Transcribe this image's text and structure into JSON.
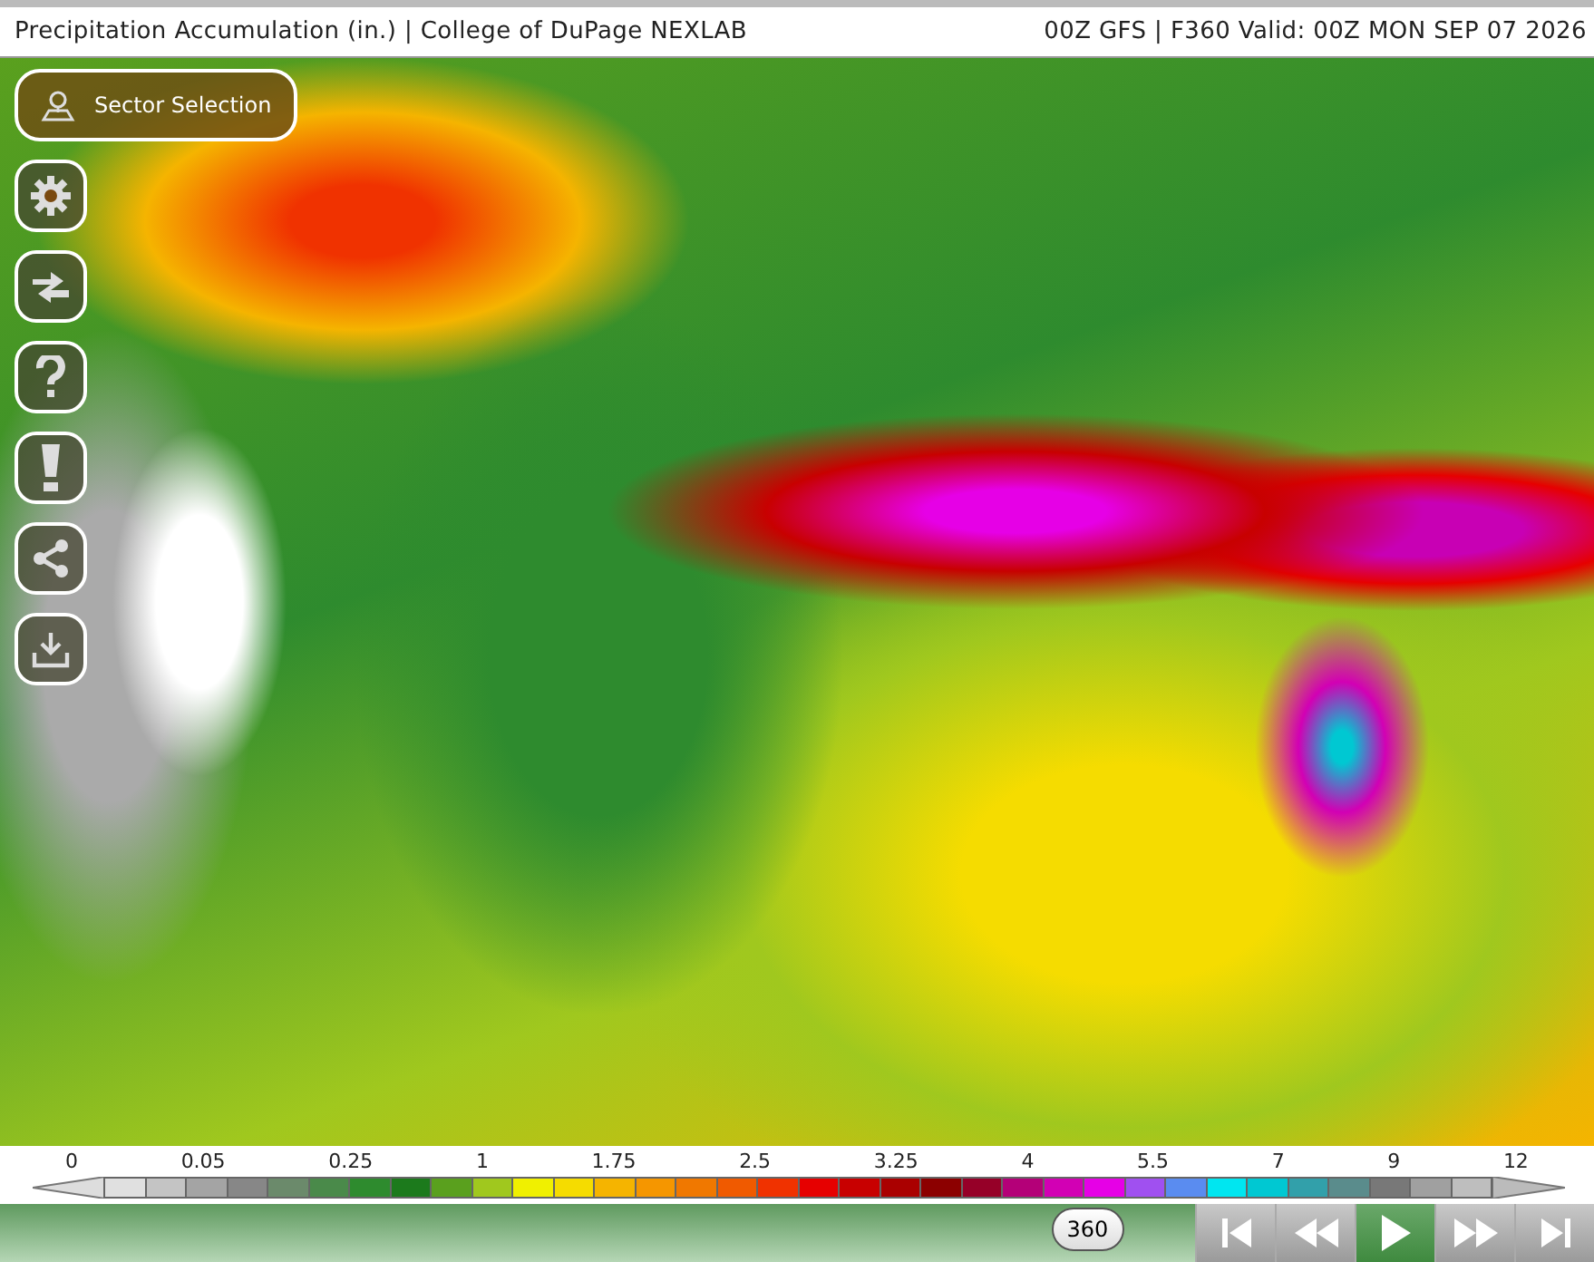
{
  "header": {
    "title": "Precipitation Accumulation (in.) | College of DuPage NEXLAB",
    "run_info": "00Z GFS | F360 Valid: 00Z MON SEP 07 2026"
  },
  "sector_button": {
    "label": "Sector Selection"
  },
  "tool_buttons": [
    {
      "kind": "settings"
    },
    {
      "kind": "swap"
    },
    {
      "kind": "help"
    },
    {
      "kind": "alert"
    },
    {
      "kind": "share"
    },
    {
      "kind": "download"
    }
  ],
  "legend": {
    "ticks": [
      "0",
      "0.05",
      "0.25",
      "1",
      "1.75",
      "2.5",
      "3.25",
      "4",
      "5.5",
      "7",
      "9",
      "12"
    ],
    "swatches": [
      {
        "color": "#e0e0e0"
      },
      {
        "color": "#c4c4c4"
      },
      {
        "color": "#a4a4a4"
      },
      {
        "color": "#878787"
      },
      {
        "color": "#6b8a6b"
      },
      {
        "color": "#4a8a4a"
      },
      {
        "color": "#2e8b2e"
      },
      {
        "color": "#1c7a1c"
      },
      {
        "color": "#5aa01e"
      },
      {
        "color": "#a0c81e"
      },
      {
        "color": "#f0f000"
      },
      {
        "color": "#f5dc00"
      },
      {
        "color": "#f5b400"
      },
      {
        "color": "#f59600"
      },
      {
        "color": "#f07800"
      },
      {
        "color": "#f05a00"
      },
      {
        "color": "#f03200"
      },
      {
        "color": "#e60000"
      },
      {
        "color": "#c80000"
      },
      {
        "color": "#aa0000"
      },
      {
        "color": "#8c0000"
      },
      {
        "color": "#960028"
      },
      {
        "color": "#b40078"
      },
      {
        "color": "#d200b4"
      },
      {
        "color": "#e600e6"
      },
      {
        "color": "#a050f0"
      },
      {
        "color": "#5a8cf0"
      },
      {
        "color": "#00e6f0"
      },
      {
        "color": "#00c8d2"
      },
      {
        "color": "#32a0aa"
      },
      {
        "color": "#5a8c8c"
      },
      {
        "color": "#787878"
      },
      {
        "color": "#a0a0a0"
      },
      {
        "color": "#bebebe"
      }
    ]
  },
  "timeline": {
    "label": "360",
    "level": 0.91
  },
  "playback": [
    {
      "kind": "first",
      "selected": false
    },
    {
      "kind": "back",
      "selected": false
    },
    {
      "kind": "play",
      "selected": true
    },
    {
      "kind": "forward",
      "selected": false
    },
    {
      "kind": "last",
      "selected": false
    }
  ]
}
